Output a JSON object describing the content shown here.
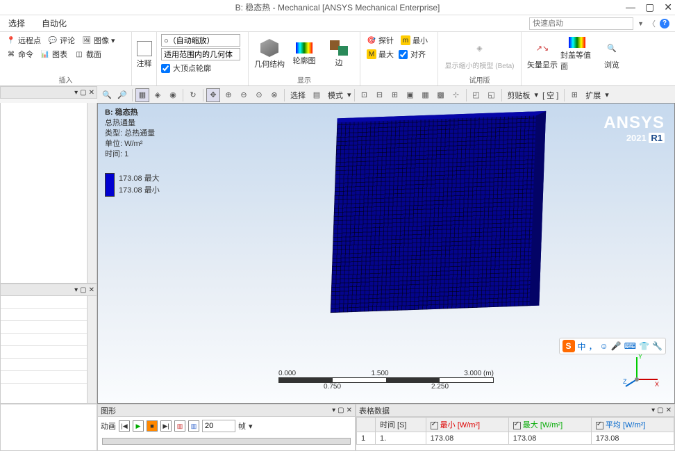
{
  "title": "B: 稳态热 - Mechanical [ANSYS Mechanical Enterprise]",
  "menubar": {
    "item1": "选择",
    "item2": "自动化",
    "searchPlaceholder": "快速启动"
  },
  "ribbon": {
    "group_insert": "插入",
    "comment": "评论",
    "image": "图像",
    "section": "截面",
    "command": "命令",
    "chart": "图表",
    "remote": "远程点",
    "annot_btn": "注释",
    "group_display": "显示",
    "auto_scale": "○（自动缩放）",
    "scope": "适用范围内的几何体",
    "vertex": "大顶点轮廓",
    "geom": "几何结构",
    "contour": "轮廓图",
    "edge": "边",
    "probe": "探针",
    "max": "最大",
    "min": "最小",
    "align": "对齐",
    "group_trial": "试用版",
    "scaled_model": "显示缩小的模型 (Beta)",
    "vector": "矢量显示",
    "cap": "封盖等值面",
    "browse": "浏览"
  },
  "toolbar": {
    "select": "选择",
    "mode": "模式",
    "clipboard": "剪贴板",
    "void": "[ 空 ]",
    "expand": "扩展"
  },
  "viewport": {
    "btitle": "B: 稳态热",
    "result_name": "总热通量",
    "type_label": "类型: 总热通量",
    "unit_label": "单位: W/m²",
    "time_label": "时间: 1",
    "max_val": "173.08 最大",
    "min_val": "173.08 最小",
    "logo1": "ANSYS",
    "logo2_a": "2021",
    "logo2_b": "R1",
    "scale": {
      "t0": "0.000",
      "t1": "0.750",
      "t2": "1.500",
      "t3": "2.250",
      "t4": "3.000 (m)"
    },
    "ime": {
      "lang": "中",
      "punc": "，"
    }
  },
  "graph_panel": {
    "title": "图形",
    "anim_label": "动画",
    "frames": "20",
    "frames_unit": "帧"
  },
  "table_panel": {
    "title": "表格数据",
    "col_time": "时间 [S]",
    "col_min": "最小 [W/m²]",
    "col_max": "最大 [W/m²]",
    "col_avg": "平均 [W/m²]",
    "row_idx": "1",
    "row_time": "1.",
    "row_min": "173.08",
    "row_max": "173.08",
    "row_avg": "173.08"
  }
}
